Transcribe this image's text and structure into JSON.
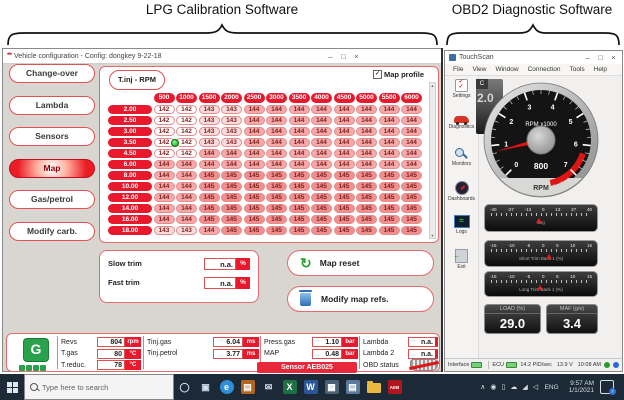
{
  "annotation": {
    "left_label": "LPG Calibration Software",
    "right_label": "OBD2 Diagnostic Software"
  },
  "window_controls": {
    "minimize": "–",
    "maximize": "□",
    "close": "×"
  },
  "lpg_window": {
    "title": "Vehicle configuration - Config: dongkey 9-22-18",
    "app_icon_glyph": "***",
    "sidebar_buttons": [
      {
        "label": "Change-over",
        "active": false
      },
      {
        "label": "Lambda",
        "active": false
      },
      {
        "label": "Sensors",
        "active": false
      },
      {
        "label": "Map",
        "active": true
      },
      {
        "label": "Gas/petrol",
        "active": false
      },
      {
        "label": "Modify carb.",
        "active": false
      }
    ],
    "map_panel": {
      "corner_label": "T.inj - RPM",
      "profile_label": "Map profile",
      "profile_checked": true,
      "col_headers": [
        "500",
        "1000",
        "1500",
        "2000",
        "2500",
        "3000",
        "3500",
        "4000",
        "4500",
        "5000",
        "5500",
        "6000"
      ],
      "row_headers": [
        "2.00",
        "2.50",
        "3.00",
        "3.50",
        "4.50",
        "6.00",
        "8.00",
        "10.00",
        "12.00",
        "14.00",
        "16.00",
        "18.00"
      ],
      "values": [
        [
          142,
          142,
          143,
          143,
          144,
          144,
          144,
          144,
          144,
          144,
          144,
          144
        ],
        [
          142,
          142,
          143,
          143,
          144,
          144,
          144,
          144,
          144,
          144,
          144,
          144
        ],
        [
          142,
          142,
          143,
          143,
          144,
          144,
          144,
          144,
          144,
          144,
          144,
          144
        ],
        [
          142,
          142,
          143,
          143,
          144,
          144,
          144,
          144,
          144,
          144,
          144,
          144
        ],
        [
          142,
          142,
          144,
          144,
          144,
          144,
          144,
          144,
          144,
          144,
          144,
          144
        ],
        [
          144,
          144,
          144,
          144,
          144,
          144,
          144,
          144,
          144,
          144,
          144,
          144
        ],
        [
          144,
          144,
          145,
          145,
          145,
          145,
          145,
          145,
          145,
          145,
          145,
          145
        ],
        [
          144,
          144,
          145,
          145,
          145,
          145,
          145,
          145,
          145,
          145,
          145,
          145
        ],
        [
          144,
          144,
          145,
          145,
          145,
          145,
          145,
          145,
          145,
          145,
          145,
          145
        ],
        [
          144,
          144,
          145,
          145,
          145,
          145,
          145,
          145,
          145,
          145,
          145,
          145
        ],
        [
          144,
          144,
          145,
          145,
          145,
          145,
          145,
          145,
          145,
          145,
          145,
          145
        ],
        [
          143,
          143,
          144,
          145,
          145,
          145,
          145,
          145,
          145,
          145,
          145,
          145
        ]
      ],
      "cell_colors": {
        "142": "#ffffff",
        "143": "#fbdcdc",
        "144": "#f6a9a9",
        "145": "#f18e8e"
      }
    },
    "trim_panel": {
      "rows": [
        {
          "label": "Slow trim",
          "value": "n.a.",
          "unit": "%"
        },
        {
          "label": "Fast trim",
          "value": "n.a.",
          "unit": "%"
        }
      ]
    },
    "buttons": {
      "map_reset": "Map reset",
      "modify_refs": "Modify map refs."
    },
    "status_panel": {
      "gas_mode_label": "G",
      "led_count": 4,
      "groups": [
        {
          "fields": [
            {
              "label": "Revs",
              "value": "804",
              "unit": "rpm"
            },
            {
              "label": "T.gas",
              "value": "80",
              "unit": "°C"
            },
            {
              "label": "T.reduc.",
              "value": "78",
              "unit": "°C"
            }
          ]
        },
        {
          "fields": [
            {
              "label": "Tinj.gas",
              "value": "6.04",
              "unit": "ms"
            },
            {
              "label": "Tinj.petrol",
              "value": "3.77",
              "unit": "ms"
            }
          ]
        },
        {
          "fields": [
            {
              "label": "Press.gas",
              "value": "1.10",
              "unit": "bar"
            },
            {
              "label": "MAP",
              "value": "0.48",
              "unit": "bar"
            }
          ],
          "banner": "Sensor AEB025"
        },
        {
          "fields": [
            {
              "label": "Lambda",
              "value": "n.a.",
              "unit": ""
            },
            {
              "label": "Lambda 2",
              "value": "n.a.",
              "unit": ""
            }
          ],
          "obd_label": "OBD status"
        }
      ]
    }
  },
  "obd_window": {
    "title": "TouchScan",
    "menu": [
      "File",
      "View",
      "Window",
      "Connection",
      "Tools",
      "Help"
    ],
    "sidebar": [
      {
        "label": "Settings",
        "icon": "settings-icon"
      },
      {
        "label": "Diagnostics",
        "icon": "diagnostics-icon"
      },
      {
        "label": "Monitors",
        "icon": "monitors-icon"
      },
      {
        "label": "Dashboards",
        "icon": "dashboards-icon"
      },
      {
        "label": "Logs",
        "icon": "logs-icon"
      },
      {
        "label": "Exit",
        "icon": "exit-icon"
      }
    ],
    "tach": {
      "face_label": "RPM x1000",
      "digital": "800",
      "caption": "RPM",
      "numbers": [
        "0",
        "1",
        "2",
        "3",
        "4",
        "5",
        "6",
        "7"
      ],
      "needle_value": 0.8,
      "redline_start": 6.3,
      "redline_end": 7.85,
      "back_tab": "C",
      "back_value": "2.0"
    },
    "bar_gauges": [
      {
        "ticks": [
          "-40",
          "-27",
          "-13",
          "0",
          "13",
          "27",
          "40"
        ],
        "label": "deg",
        "pointer_frac": 0.48
      },
      {
        "ticks": [
          "-15",
          "-10",
          "-5",
          "0",
          "5",
          "10",
          "15"
        ],
        "label": "Short Trim Bank 1 (%)",
        "pointer_frac": 0.57
      },
      {
        "ticks": [
          "-15",
          "-10",
          "-5",
          "0",
          "5",
          "10",
          "15"
        ],
        "label": "Long Trim Bank 1 (%)",
        "pointer_frac": 0.49
      }
    ],
    "readouts": [
      {
        "label": "LOAD (%)",
        "value": "29.0"
      },
      {
        "label": "MAF (g/s)",
        "value": "3.4"
      }
    ],
    "status_bar": {
      "interface_label": "Interface",
      "ecu_label": "ECU",
      "pid_rate": "14.2 PID/sec",
      "voltage": "13.9 V",
      "time": "10:08 AM"
    }
  },
  "taskbar": {
    "search_placeholder": "Type here to search",
    "apps": [
      {
        "name": "cortana-icon",
        "glyph": "◯",
        "bg": "",
        "fg": "#cfe0ee",
        "shape": "plain"
      },
      {
        "name": "task-view-icon",
        "glyph": "▣",
        "bg": "",
        "fg": "#cfe0ee",
        "shape": "plain"
      },
      {
        "name": "edge-icon",
        "glyph": "e",
        "bg": "#2f8ed8",
        "fg": "#ffffff",
        "shape": "circle"
      },
      {
        "name": "store-icon",
        "glyph": "▤",
        "bg": "#b5651d",
        "fg": "#ffffff",
        "shape": "square"
      },
      {
        "name": "mail-icon",
        "glyph": "✉",
        "bg": "",
        "fg": "#cfe0ee",
        "shape": "plain"
      },
      {
        "name": "excel-icon",
        "glyph": "X",
        "bg": "#1e7145",
        "fg": "#ffffff",
        "shape": "square"
      },
      {
        "name": "word-icon",
        "glyph": "W",
        "bg": "#2b579a",
        "fg": "#ffffff",
        "shape": "square"
      },
      {
        "name": "calculator-icon",
        "glyph": "▦",
        "bg": "#4a6075",
        "fg": "#ffffff",
        "shape": "square"
      },
      {
        "name": "application-icon",
        "glyph": "▤",
        "bg": "#5b7a9d",
        "fg": "#ffffff",
        "shape": "square"
      },
      {
        "name": "file-explorer-icon",
        "glyph": "",
        "bg": "",
        "fg": "",
        "shape": "folder"
      },
      {
        "name": "aeb-app-icon",
        "glyph": "AEB",
        "bg": "#b2151b",
        "fg": "#ffffff",
        "shape": "square"
      }
    ],
    "tray_icons": [
      {
        "name": "tray-chevron-icon",
        "glyph": "∧"
      },
      {
        "name": "tray-contact-icon",
        "glyph": "◉"
      },
      {
        "name": "battery-icon",
        "glyph": "▯"
      },
      {
        "name": "onedrive-icon",
        "glyph": "☁"
      },
      {
        "name": "network-icon",
        "glyph": "◢"
      },
      {
        "name": "volume-icon",
        "glyph": "◁"
      }
    ],
    "language": "ENG",
    "time": "9:57 AM",
    "date": "1/1/2021",
    "notification_badge": "7"
  }
}
